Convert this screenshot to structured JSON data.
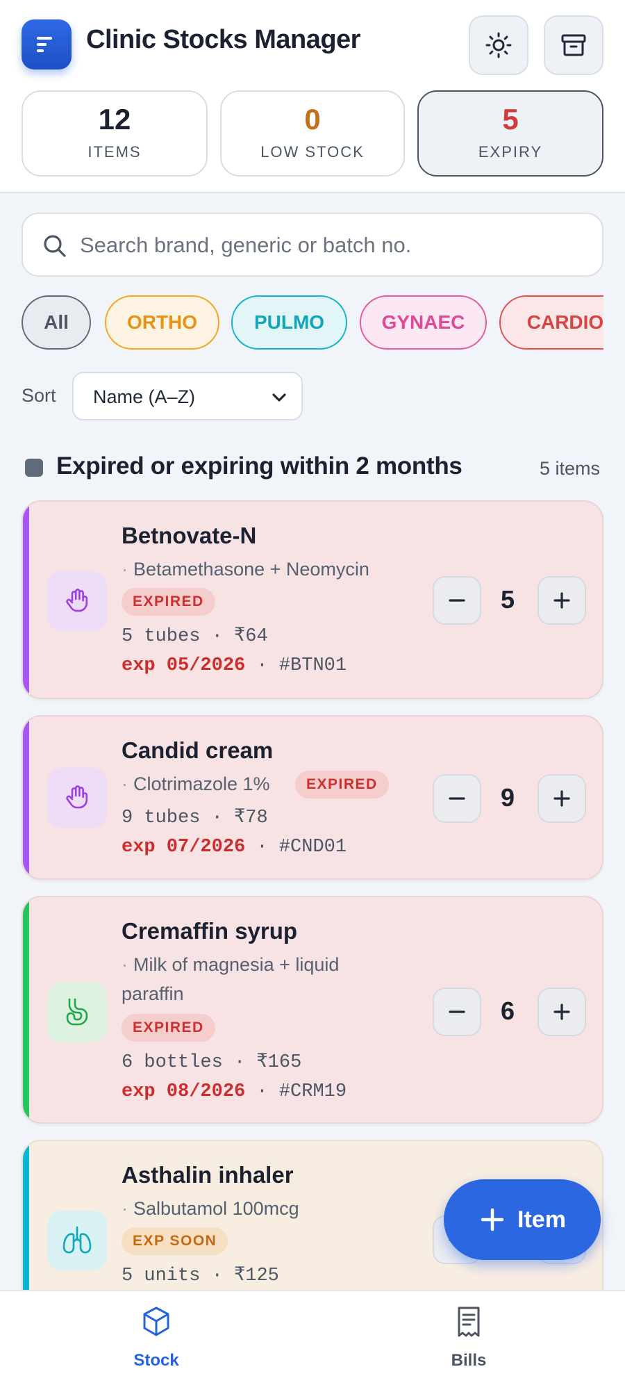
{
  "app": {
    "title": "Clinic Stocks Manager"
  },
  "header": {
    "theme_icon": "sun-icon",
    "archive_icon": "archive-icon",
    "stats": [
      {
        "value": "12",
        "label": "ITEMS"
      },
      {
        "value": "0",
        "label": "LOW STOCK"
      },
      {
        "value": "5",
        "label": "EXPIRY"
      }
    ]
  },
  "search": {
    "placeholder": "Search brand, generic or batch no.",
    "value": ""
  },
  "chips": [
    {
      "label": "All",
      "selected": true
    },
    {
      "label": "ORTHO",
      "color": "#f0a81e"
    },
    {
      "label": "PULMO",
      "color": "#16b3c7"
    },
    {
      "label": "GYNAEC",
      "color": "#e35aa0"
    },
    {
      "label": "CARDIO",
      "color": "#e05252"
    }
  ],
  "sort": {
    "label": "Sort",
    "value": "Name (A–Z)"
  },
  "section": {
    "title": "Expired or expiring within 2 months",
    "count": "5 items"
  },
  "cards": [
    {
      "name": "Betnovate-N",
      "generic": "Betamethasone + Neomycin",
      "badge": "EXPIRED",
      "qty_line": "5 tubes · ₹64",
      "exp": "exp 05/2026",
      "batch": " · #BTN01",
      "count": "5",
      "icon": "hand-icon",
      "accent": "#a855f7"
    },
    {
      "name": "Candid cream",
      "generic": "Clotrimazole 1%",
      "badge": "EXPIRED",
      "qty_line": "9 tubes · ₹78",
      "exp": "exp 07/2026",
      "batch": " · #CND01",
      "count": "9",
      "icon": "hand-icon",
      "accent": "#a855f7"
    },
    {
      "name": "Cremaffin syrup",
      "generic_line1": "Milk of magnesia + liquid",
      "generic_line2": "paraffin",
      "badge": "EXPIRED",
      "qty_line": "6 bottles · ₹165",
      "exp": "exp 08/2026",
      "batch": " · #CRM19",
      "count": "6",
      "icon": "stomach-icon",
      "accent": "#22c55e"
    },
    {
      "name": "Asthalin inhaler",
      "generic": "Salbutamol 100mcg",
      "badge": "EXP SOON",
      "qty_line": "5 units · ₹125",
      "icon": "lungs-icon",
      "accent": "#06b6d4"
    }
  ],
  "fab": {
    "label": "Item"
  },
  "nav": [
    {
      "label": "Stock",
      "icon": "box-icon",
      "active": true
    },
    {
      "label": "Bills",
      "icon": "receipt-icon"
    }
  ],
  "colors": {
    "accent": "#2a67e0",
    "expired_bg": "#f7e3e3",
    "soon_bg": "#f8ede1",
    "danger": "#cc2e2e"
  }
}
